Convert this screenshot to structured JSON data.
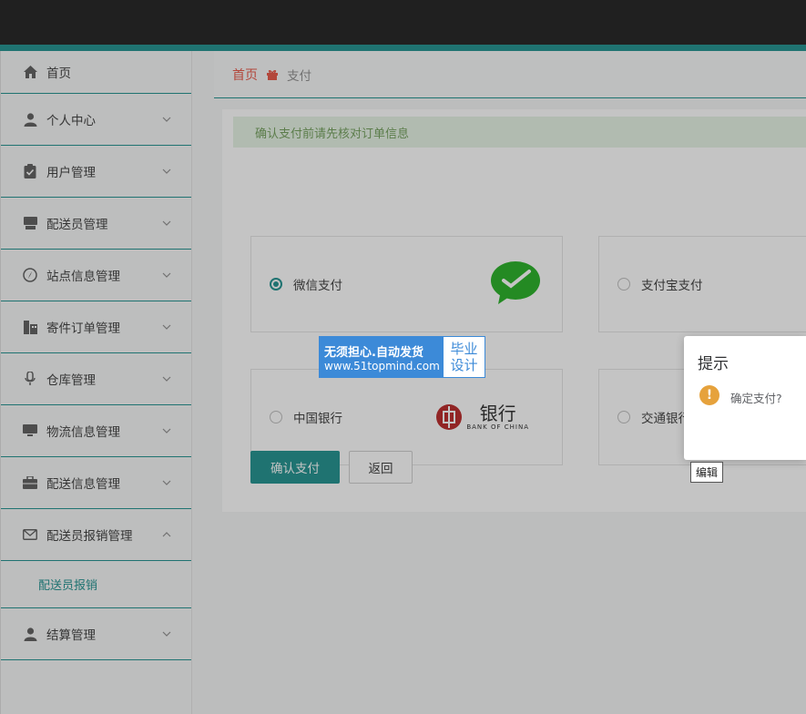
{
  "sidebar": {
    "items": [
      {
        "label": "首页",
        "icon": "home-icon"
      },
      {
        "label": "个人中心",
        "icon": "user-icon"
      },
      {
        "label": "用户管理",
        "icon": "clipboard-icon"
      },
      {
        "label": "配送员管理",
        "icon": "printer-icon"
      },
      {
        "label": "站点信息管理",
        "icon": "compass-icon"
      },
      {
        "label": "寄件订单管理",
        "icon": "building-icon"
      },
      {
        "label": "仓库管理",
        "icon": "microphone-icon"
      },
      {
        "label": "物流信息管理",
        "icon": "monitor-icon"
      },
      {
        "label": "配送信息管理",
        "icon": "briefcase-icon"
      },
      {
        "label": "配送员报销管理",
        "icon": "mail-icon"
      },
      {
        "label": "结算管理",
        "icon": "user-icon"
      }
    ],
    "sub_item": "配送员报销"
  },
  "breadcrumb": {
    "home": "首页",
    "current": "支付"
  },
  "notice": "确认支付前请先核对订单信息",
  "payment": {
    "options": [
      {
        "label": "微信支付",
        "selected": true,
        "logo": "wechat-logo-icon"
      },
      {
        "label": "支付宝支付",
        "selected": false
      },
      {
        "label": "中国银行",
        "selected": false,
        "logo": "bank-of-china-logo-icon",
        "logo_text_cn": "银行",
        "logo_text_en": "BANK OF CHINA"
      },
      {
        "label": "交通银行",
        "selected": false
      }
    ],
    "confirm_label": "确认支付",
    "back_label": "返回"
  },
  "watermark": {
    "line1": "无须担心.自动发货",
    "line2": "www.51topmind.com",
    "right1": "毕业",
    "right2": "设计"
  },
  "dialog": {
    "title": "提示",
    "message": "确定支付?",
    "icon": "!"
  },
  "tooltip": "编辑",
  "colors": {
    "accent": "#138b89",
    "home_red": "#e74c3c",
    "warning": "#e6a23c",
    "wechat_green": "#1aad19"
  }
}
